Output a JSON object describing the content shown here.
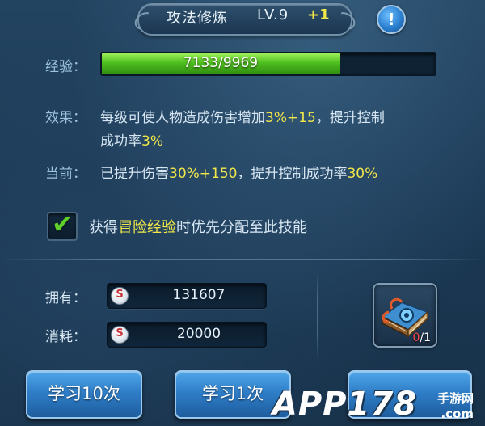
{
  "header": {
    "title": "攻法修炼",
    "level": "LV.9",
    "bonus": "+1",
    "info_glyph": "!"
  },
  "experience": {
    "label": "经验：",
    "text": "7133/9969",
    "current": 7133,
    "max": 9969,
    "fill_color": "#4fbf1f"
  },
  "effect": {
    "label": "效果：",
    "line1_prefix": "每级可使人物造成伤害增加",
    "line1_value": "3%+15",
    "line1_suffix": "，提升控制",
    "line2_prefix": "成功率",
    "line2_value": "3%"
  },
  "current": {
    "label": "当前：",
    "prefix": "已提升伤害",
    "damage": "30%+150",
    "middle": "，提升控制成功率",
    "control": "30%"
  },
  "auto_assign": {
    "checked": true,
    "check_glyph": "✔",
    "prefix": "获得",
    "highlight": "冒险经验",
    "suffix": "时优先分配至此技能"
  },
  "resources": {
    "owned_label": "拥有：",
    "owned_value": "131607",
    "cost_label": "消耗：",
    "cost_value": "20000",
    "currency_icon": "silver-coin-icon"
  },
  "item": {
    "icon": "skill-book-icon",
    "count_current": "0",
    "count_sep": "/1"
  },
  "buttons": {
    "learn_10": "学习10次",
    "learn_1": "学习1次"
  },
  "watermark": {
    "logo": "APP178",
    "cn": "手游网",
    "com": ".com"
  },
  "colors": {
    "highlight": "#f2e84a",
    "label": "#9ec3de",
    "text": "#d6e6f2",
    "button": "#2f7ec8"
  }
}
